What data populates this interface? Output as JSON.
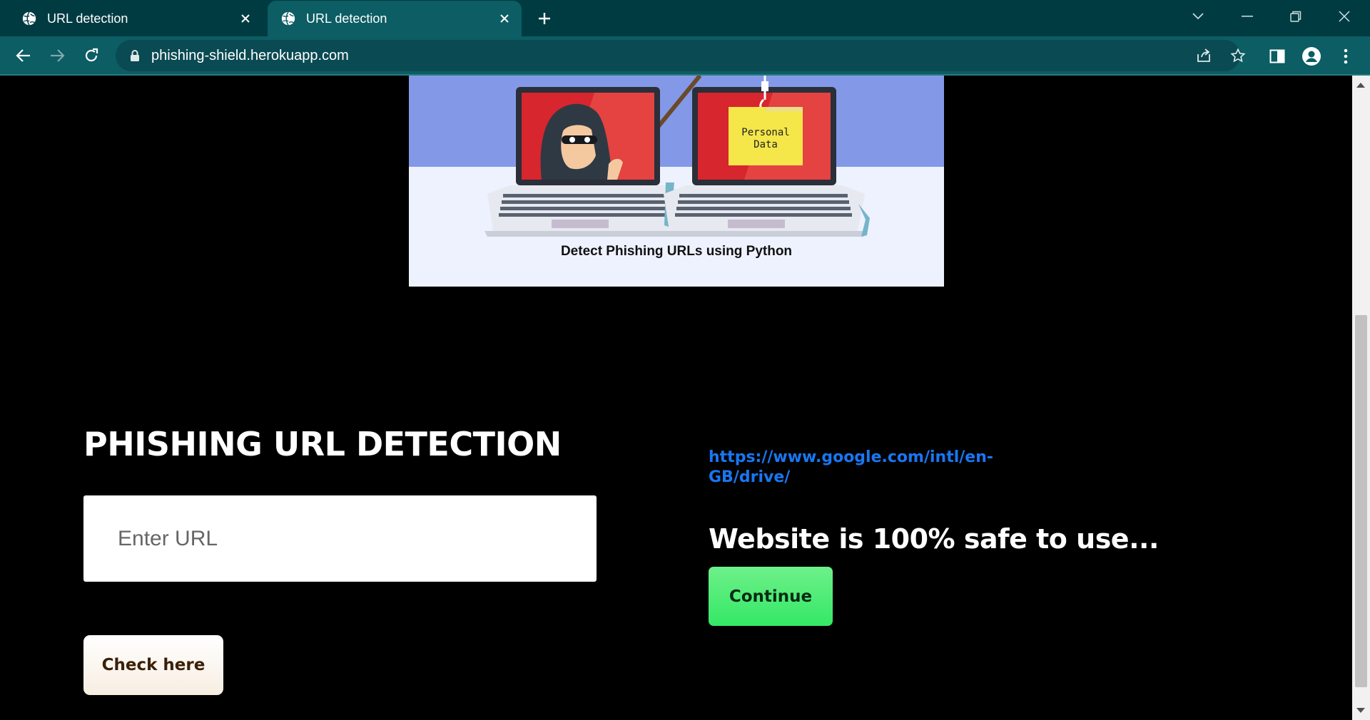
{
  "browser": {
    "tabs": [
      {
        "title": "URL detection",
        "active": false
      },
      {
        "title": "URL detection",
        "active": true
      }
    ],
    "address": "phishing-shield.herokuapp.com"
  },
  "banner": {
    "personal_data_line1": "Personal",
    "personal_data_line2": "Data",
    "caption": "Detect Phishing URLs using Python"
  },
  "form": {
    "heading": "PHISHING URL DETECTION",
    "input_placeholder": "Enter URL",
    "input_value": "",
    "check_button": "Check here"
  },
  "result": {
    "url": "https://www.google.com/intl/en-GB/drive/",
    "message": "Website is 100% safe to use...",
    "continue_button": "Continue"
  },
  "colors": {
    "chrome_tabbar": "#003b42",
    "chrome_toolbar": "#0c5d64",
    "link": "#1877f2",
    "continue_green": "#34e866"
  }
}
